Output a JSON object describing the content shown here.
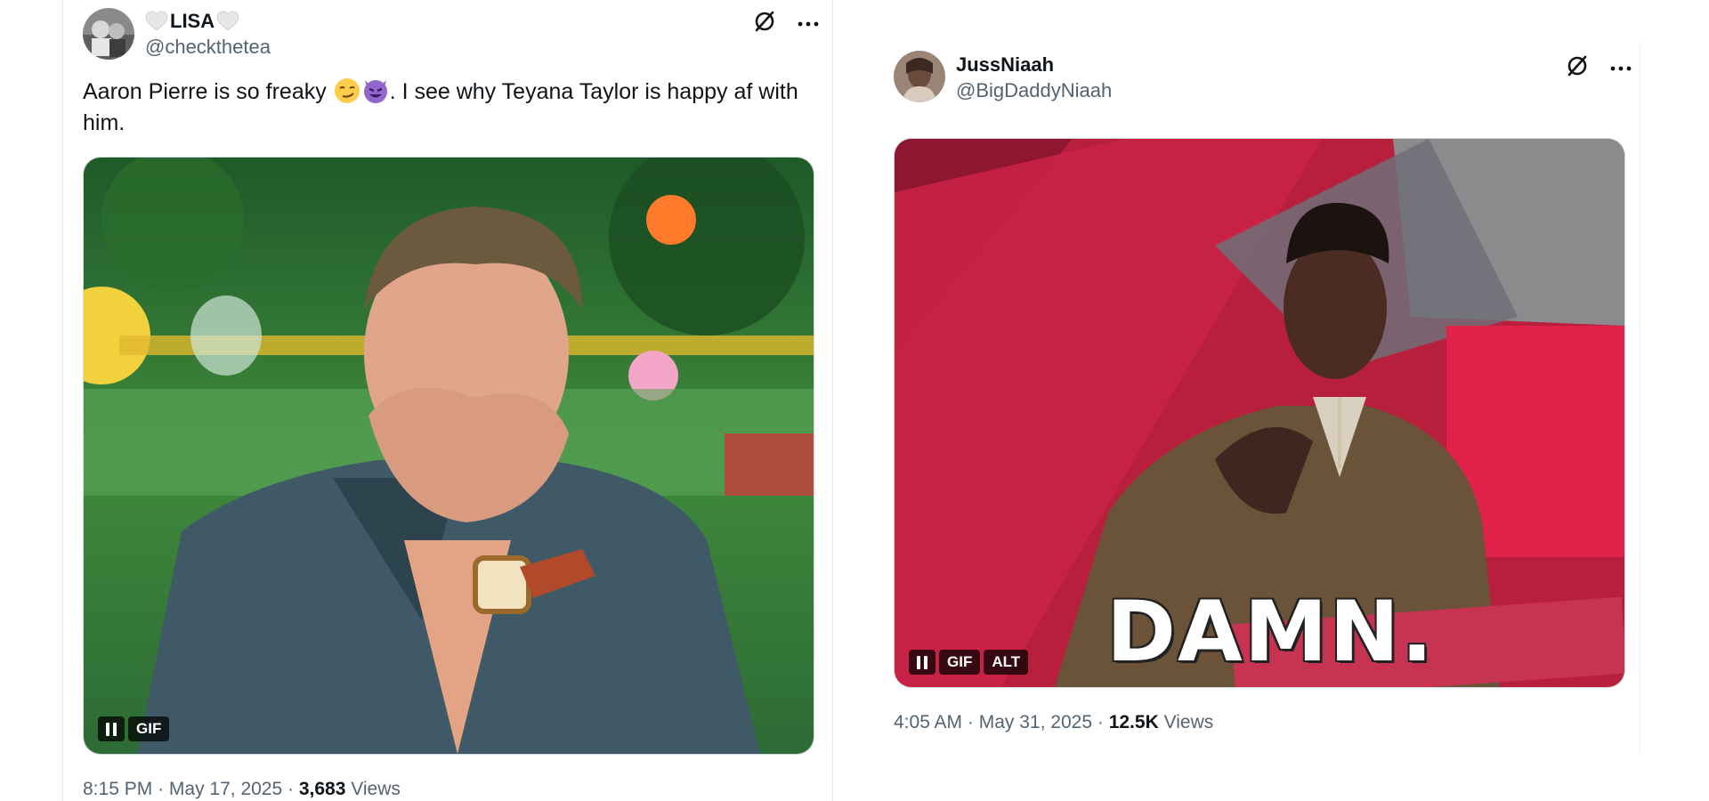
{
  "tweets": [
    {
      "name": "LISA",
      "handle": "@checkthetea",
      "text_part1": "Aaron Pierre is so freaky",
      "text_part2": ". I see why  Teyana Taylor is happy af with him.",
      "emojis": [
        "smirking-face",
        "smiling-imp"
      ],
      "media_badges": [
        "GIF"
      ],
      "time": "8:15 PM",
      "date": "May 17, 2025",
      "views_count": "3,683",
      "views_label": "Views",
      "sep": "·"
    },
    {
      "name": "JussNiaah",
      "handle": "@BigDaddyNiaah",
      "caption": "DAMN.",
      "media_badges": [
        "GIF",
        "ALT"
      ],
      "time": "4:05 AM",
      "date": "May 31, 2025",
      "views_count": "12.5K",
      "views_label": "Views",
      "sep": "·"
    }
  ],
  "colors": {
    "text": "#0f1419",
    "secondary": "#536471",
    "border": "#cfd9de"
  },
  "icons": [
    "heart-icon",
    "grok-icon",
    "more-icon",
    "pause-icon"
  ]
}
